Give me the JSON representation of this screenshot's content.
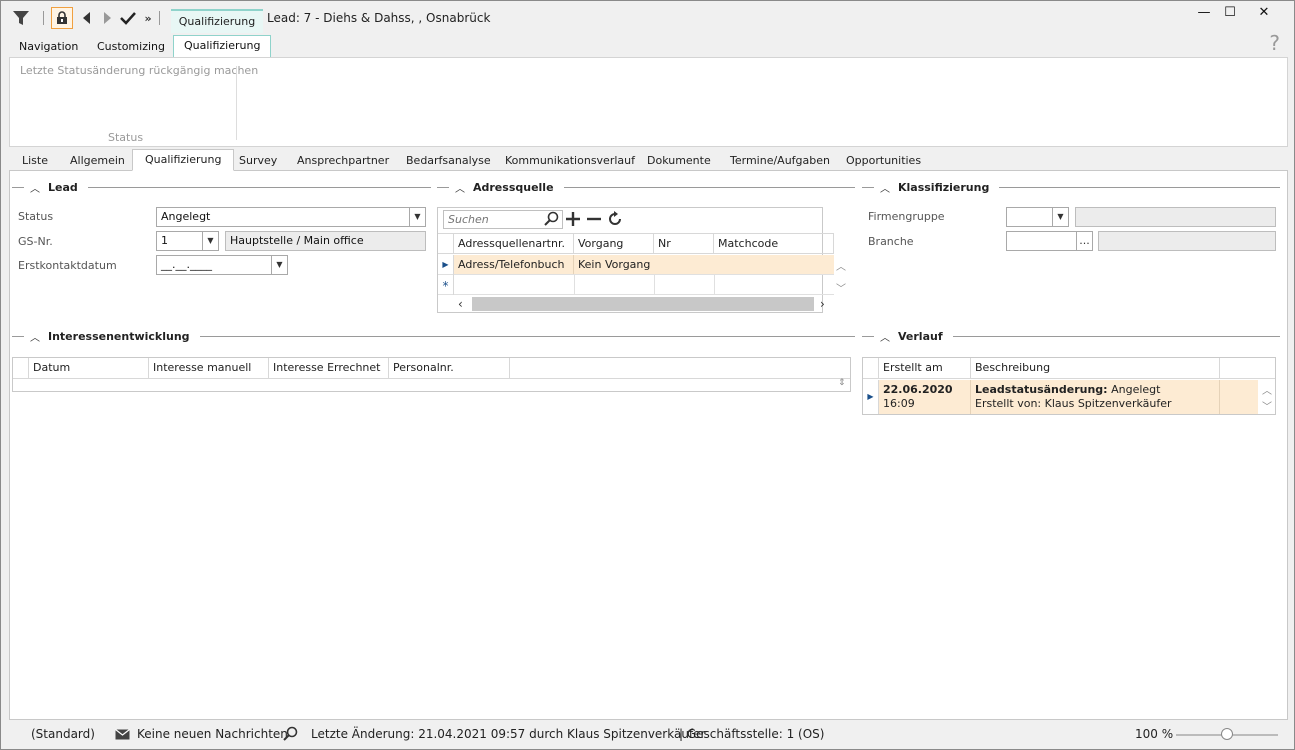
{
  "window": {
    "title": "Lead: 7 - Diehs & Dahss, , Osnabrück",
    "context_tab": "Qualifizierung",
    "minimize": "—",
    "maximize": "☐",
    "close": "✕"
  },
  "ribbon": {
    "tabs": [
      "Navigation",
      "Customizing",
      "Qualifizierung"
    ],
    "help": "?",
    "command": "Letzte Statusänderung rückgängig machen",
    "group_label": "Status"
  },
  "tabs": [
    "Liste",
    "Allgemein",
    "Qualifizierung",
    "Survey",
    "Ansprechpartner",
    "Bedarfsanalyse",
    "Kommunikationsverlauf",
    "Dokumente",
    "Termine/Aufgaben",
    "Opportunities"
  ],
  "lead": {
    "title": "Lead",
    "status_label": "Status",
    "status_value": "Angelegt",
    "gs_label": "GS-Nr.",
    "gs_value": "1",
    "gs_name": "Hauptstelle / Main office",
    "erstkontakt_label": "Erstkontaktdatum",
    "erstkontakt_value": "__.__.____"
  },
  "adressquelle": {
    "title": "Adressquelle",
    "search_placeholder": "Suchen",
    "columns": [
      "Adressquellenartnr.",
      "Vorgang",
      "Nr",
      "Matchcode"
    ],
    "rows": [
      {
        "artnr": "Adress/Telefonbuch",
        "vorgang": "Kein Vorgang",
        "nr": "",
        "matchcode": ""
      }
    ],
    "new_row_marker": "*"
  },
  "klassifizierung": {
    "title": "Klassifizierung",
    "firmengruppe_label": "Firmengruppe",
    "branche_label": "Branche",
    "ellipsis": "..."
  },
  "interessen": {
    "title": "Interessenentwicklung",
    "columns": [
      "Datum",
      "Interesse manuell",
      "Interesse Errechnet",
      "Personalnr."
    ]
  },
  "verlauf": {
    "title": "Verlauf",
    "columns": [
      "Erstellt am",
      "Beschreibung"
    ],
    "rows": [
      {
        "date": "22.06.2020",
        "time": "16:09",
        "desc_bold": "Leadstatusänderung:",
        "desc_value": " Angelegt",
        "desc_line2": "Erstellt von: Klaus Spitzenverkäufer"
      }
    ]
  },
  "statusbar": {
    "profile": "(Standard)",
    "messages": "Keine neuen Nachrichten",
    "last_change": "Letzte Änderung: 21.04.2021 09:57 durch Klaus Spitzenverkäufer",
    "branch": "| Geschäftsstelle:  1 (OS)",
    "zoom": "100 %",
    "zoom_level": 0.5
  },
  "colors": {
    "accent": "#8fd3cb",
    "highlight_row": "#fdebd3",
    "lock_border": "#f0a040"
  }
}
